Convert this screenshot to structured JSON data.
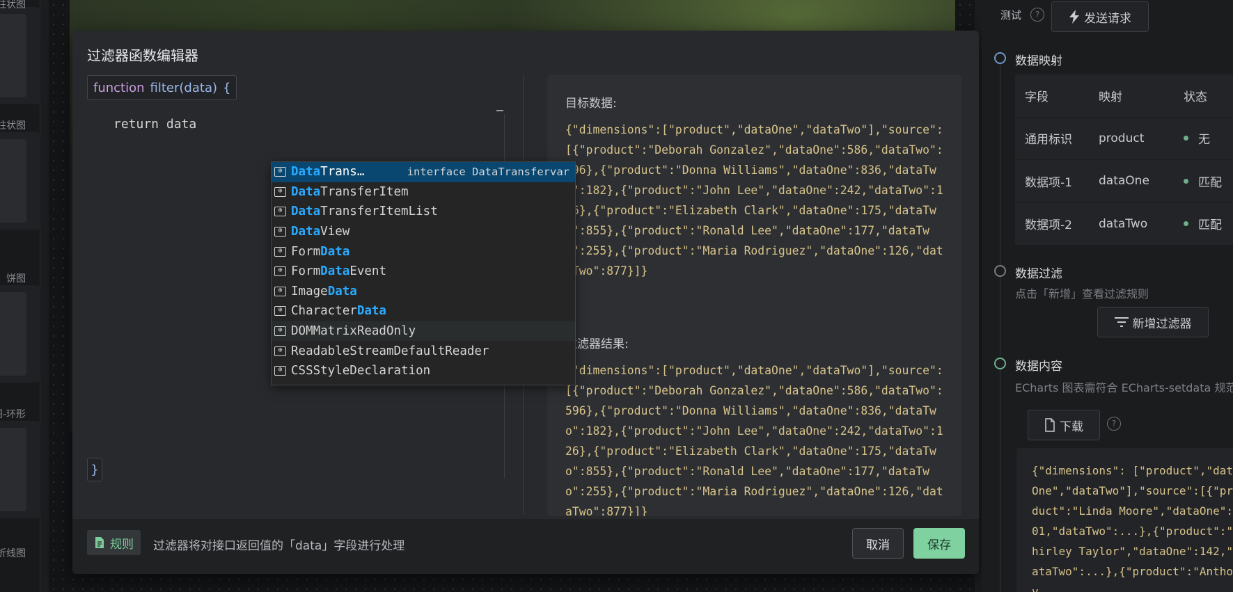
{
  "left_strip": {
    "labels": [
      "柱状图",
      "柱状图",
      "饼图",
      "饼图-环形",
      "折线图"
    ]
  },
  "modal": {
    "title": "过滤器函数编辑器",
    "fn_header": {
      "keyword": "function",
      "signature": "filter(data)",
      "brace": "{"
    },
    "code_line": "return data",
    "closing_brace": "}",
    "suggest": {
      "selected_label": "DataTrans…",
      "selected_detail": "interface DataTransfervar",
      "icon": "variable-icon",
      "items": [
        "DataTransferItem",
        "DataTransferItemList",
        "DataView",
        "FormData",
        "FormDataEvent",
        "ImageData",
        "CharacterData",
        "DOMMatrixReadOnly",
        "ReadableStreamDefaultReader",
        "CSSStyleDeclaration"
      ]
    },
    "target": {
      "title": "目标数据:",
      "json": "{\"dimensions\":[\"product\",\"dataOne\",\"dataTwo\"],\"source\":[{\"product\":\"Deborah Gonzalez\",\"dataOne\":586,\"dataTwo\":596},{\"product\":\"Donna Williams\",\"dataOne\":836,\"dataTwo\":182},{\"product\":\"John Lee\",\"dataOne\":242,\"dataTwo\":126},{\"product\":\"Elizabeth Clark\",\"dataOne\":175,\"dataTwo\":855},{\"product\":\"Ronald Lee\",\"dataOne\":177,\"dataTwo\":255},{\"product\":\"Maria Rodriguez\",\"dataOne\":126,\"dataTwo\":877}]}"
    },
    "result": {
      "title": "过滤器结果:",
      "json": "{\"dimensions\":[\"product\",\"dataOne\",\"dataTwo\"],\"source\":[{\"product\":\"Deborah Gonzalez\",\"dataOne\":586,\"dataTwo\":596},{\"product\":\"Donna Williams\",\"dataOne\":836,\"dataTwo\":182},{\"product\":\"John Lee\",\"dataOne\":242,\"dataTwo\":126},{\"product\":\"Elizabeth Clark\",\"dataOne\":175,\"dataTwo\":855},{\"product\":\"Ronald Lee\",\"dataOne\":177,\"dataTwo\":255},{\"product\":\"Maria Rodriguez\",\"dataOne\":126,\"dataTwo\":877}]}"
    },
    "footer": {
      "rule_label": "规则",
      "rule_desc": "过滤器将对接口返回值的「data」字段进行处理",
      "cancel": "取消",
      "save": "保存"
    }
  },
  "right_panel": {
    "test_label": "测试",
    "help_glyph": "?",
    "send_button": "发送请求",
    "mapping": {
      "title": "数据映射",
      "headers": [
        "字段",
        "映射",
        "状态"
      ],
      "rows": [
        {
          "field": "通用标识",
          "map": "product",
          "status": "无"
        },
        {
          "field": "数据项-1",
          "map": "dataOne",
          "status": "匹配"
        },
        {
          "field": "数据项-2",
          "map": "dataTwo",
          "status": "匹配"
        }
      ]
    },
    "filter": {
      "title": "数据过滤",
      "desc": "点击「新增」查看过滤规则",
      "add_button": "新增过滤器"
    },
    "content": {
      "title": "数据内容",
      "desc": "ECharts 图表需符合 ECharts-setdata 规范",
      "download_button": "下载",
      "json": "{\"dimensions\":\n[\"product\",\"dataOne\",\"dataTwo\"],\"source\":[{\"product\":\"Linda Moore\",\"dataOne\":601,\"dataTwo\":...},{\"product\":\"Shirley Taylor\",\"dataOne\":142,\"dataTwo\":...},{\"product\":\"Anthony"
    }
  },
  "colors": {
    "accent_green": "#7fd1a0",
    "suggest_highlight": "#2aaaff",
    "json_text": "#d6c28a"
  }
}
